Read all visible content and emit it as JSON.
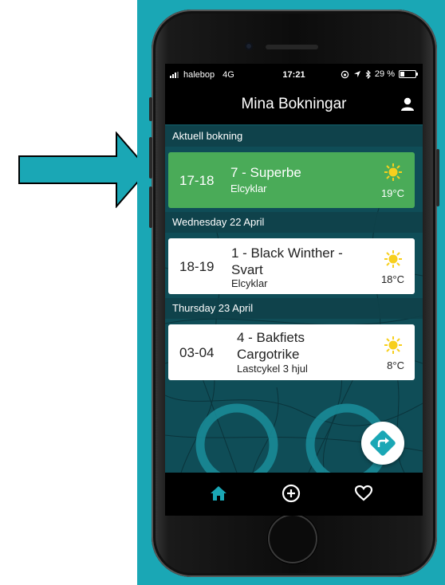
{
  "status_bar": {
    "carrier": "halebop",
    "network": "4G",
    "time": "17:21",
    "battery": "29 %",
    "battery_level": 0.29
  },
  "header": {
    "title": "Mina Bokningar",
    "user_icon": "user-icon"
  },
  "sections": [
    {
      "label": "Aktuell bokning",
      "bookings": [
        {
          "time": "17-18",
          "name": "7 - Superbe",
          "category": "Elcyklar",
          "weather_icon": "sun-icon",
          "temperature": "19°C",
          "current": true
        }
      ]
    },
    {
      "label": "Wednesday 22 April",
      "bookings": [
        {
          "time": "18-19",
          "name": "1 - Black Winther - Svart",
          "category": "Elcyklar",
          "weather_icon": "sun-icon",
          "temperature": "18°C",
          "current": false
        }
      ]
    },
    {
      "label": "Thursday 23 April",
      "bookings": [
        {
          "time": "03-04",
          "name": "4 - Bakfiets Cargotrike",
          "category": "Lastcykel 3 hjul",
          "weather_icon": "sun-icon",
          "temperature": "8°C",
          "current": false
        }
      ]
    }
  ],
  "fab_icon": "directions-icon",
  "tabs": [
    {
      "icon": "home-icon",
      "active": true
    },
    {
      "icon": "add-circle-icon",
      "active": false
    },
    {
      "icon": "heart-icon",
      "active": false
    }
  ],
  "colors": {
    "backdrop_teal": "#1aa7b5",
    "current_booking_green": "#4aab58",
    "section_header_bg": "#0f414a",
    "active_tab": "#1aa7b5",
    "sun_yellow": "#f7cf1d"
  }
}
